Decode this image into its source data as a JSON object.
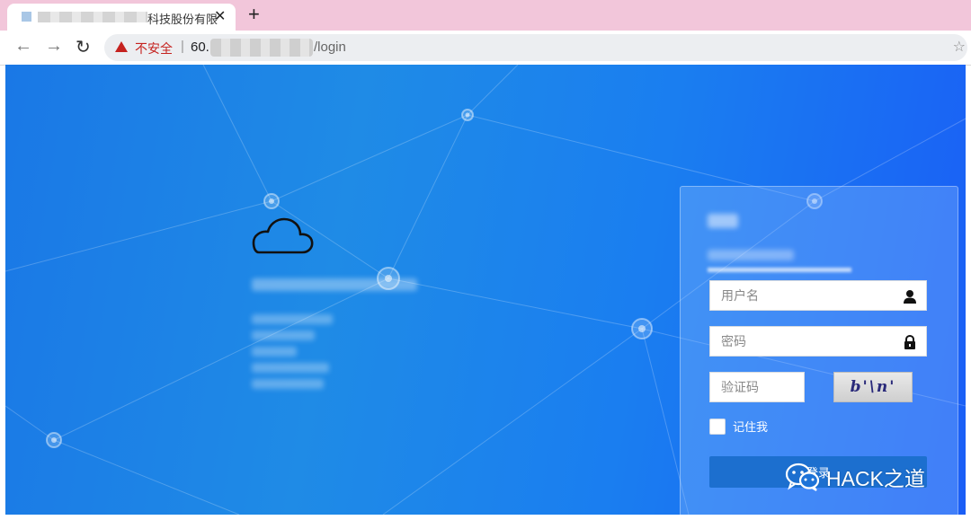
{
  "browser": {
    "tab": {
      "title_visible": "科技股份有限",
      "close_glyph": "✕"
    },
    "new_tab_glyph": "+",
    "nav": {
      "back": "←",
      "forward": "→",
      "reload": "↻"
    },
    "address": {
      "security_label": "不安全",
      "separator": "|",
      "url_prefix": "60.",
      "url_suffix": "/login",
      "star_glyph": "☆"
    }
  },
  "login": {
    "username_placeholder": "用户名",
    "password_placeholder": "密码",
    "captcha_placeholder": "验证码",
    "captcha_text": "b'\\n'",
    "remember_label": "记住我",
    "login_button_label": "登录"
  },
  "watermark": {
    "text": "HACK之道"
  },
  "colors": {
    "tabstrip": "#f2c6da",
    "page_gradient_start": "#1a78e6",
    "page_gradient_end": "#1a5ef6",
    "insecure_red": "#c5221f",
    "login_button": "#1c6fcf"
  },
  "icons": [
    "cloud-icon",
    "user-icon",
    "lock-icon",
    "warning-icon",
    "wechat-icon"
  ]
}
